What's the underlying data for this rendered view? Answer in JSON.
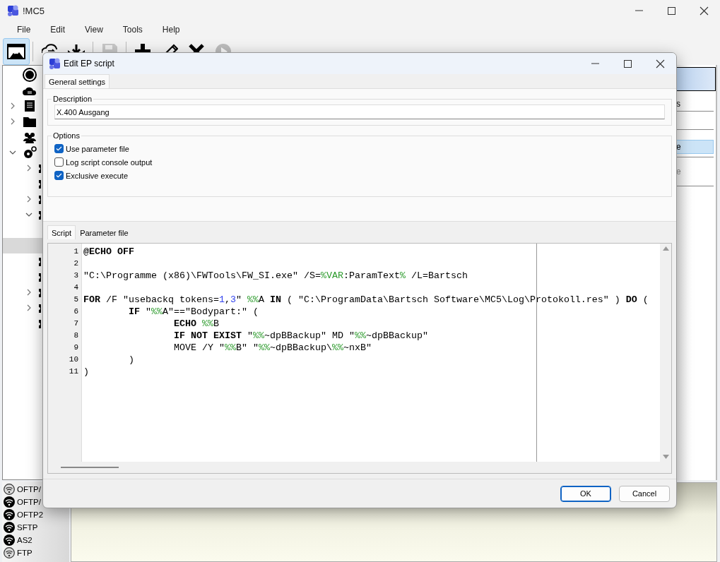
{
  "window": {
    "title": "!MC5"
  },
  "menu": [
    "File",
    "Edit",
    "View",
    "Tools",
    "Help"
  ],
  "toolbar": [
    {
      "kind": "button",
      "pressed": true,
      "disabled": false
    },
    {
      "kind": "separator"
    },
    {
      "kind": "button",
      "pressed": false,
      "disabled": false
    },
    {
      "kind": "button",
      "pressed": false,
      "disabled": false
    },
    {
      "kind": "separator"
    },
    {
      "kind": "button",
      "pressed": false,
      "disabled": true
    },
    {
      "kind": "separator"
    },
    {
      "kind": "button",
      "pressed": false,
      "disabled": false
    },
    {
      "kind": "button",
      "pressed": false,
      "disabled": false
    },
    {
      "kind": "button",
      "pressed": false,
      "disabled": false
    },
    {
      "kind": "button",
      "pressed": false,
      "disabled": true
    }
  ],
  "tree": [
    {
      "selected": false
    },
    {
      "selected": false
    },
    {
      "selected": false,
      "expanded": false
    },
    {
      "selected": false,
      "expanded": false
    },
    {
      "selected": false
    },
    {
      "selected": false,
      "expanded": true,
      "children": [
        {
          "selected": false,
          "expanded": false
        },
        {
          "selected": false
        },
        {
          "selected": false,
          "expanded": false
        },
        {
          "selected": false,
          "expanded": true,
          "children": [
            {
              "selected": false
            },
            {
              "selected": true
            }
          ]
        },
        {
          "selected": false
        },
        {
          "selected": false
        },
        {
          "selected": false,
          "expanded": false
        },
        {
          "selected": false,
          "expanded": false
        },
        {
          "selected": false
        }
      ]
    }
  ],
  "protocols": [
    {
      "label": "OFTP/",
      "active": false
    },
    {
      "label": "OFTP/",
      "active": true
    },
    {
      "label": "OFTP2",
      "active": true
    },
    {
      "label": "SFTP",
      "active": true
    },
    {
      "label": "AS2",
      "active": true
    },
    {
      "label": "FTP",
      "active": false
    }
  ],
  "right_panel": {
    "items": [
      {
        "label": "s",
        "selected": false,
        "disabled": false
      },
      {
        "label": "e",
        "selected": true,
        "disabled": false
      },
      {
        "label": "e",
        "selected": false,
        "disabled": true
      }
    ]
  },
  "dialog": {
    "title": "Edit EP script",
    "tabs": [
      {
        "label": "General settings",
        "selected": true
      }
    ],
    "description": {
      "label": "Description",
      "value": "X.400 Ausgang"
    },
    "options": {
      "label": "Options",
      "items": [
        {
          "label": "Use parameter file",
          "checked": true
        },
        {
          "label": "Log script console output",
          "checked": false
        },
        {
          "label": "Exclusive execute",
          "checked": true
        }
      ]
    },
    "editor_tabs": [
      {
        "label": "Script",
        "selected": true
      },
      {
        "label": "Parameter file",
        "selected": false
      }
    ],
    "script": [
      {
        "number": "1",
        "tokens": [
          {
            "kind": "keyword",
            "text": "@ECHO OFF"
          }
        ]
      },
      {
        "number": "2"
      },
      {
        "number": "3",
        "tokens": [
          {
            "kind": "plain",
            "text": "\"C:\\Programme (x86)\\FWTools\\FW_SI.exe\" /S="
          },
          {
            "kind": "variable",
            "text": "%VAR"
          },
          {
            "kind": "plain",
            "text": ":ParamText"
          },
          {
            "kind": "variable",
            "text": "%"
          },
          {
            "kind": "plain",
            "text": " /L=Bartsch"
          }
        ]
      },
      {
        "number": "4"
      },
      {
        "number": "5",
        "tokens": [
          {
            "kind": "keyword",
            "text": "FOR"
          },
          {
            "kind": "plain",
            "text": " /F \"usebackq tokens="
          },
          {
            "kind": "number",
            "text": "1"
          },
          {
            "kind": "plain",
            "text": ","
          },
          {
            "kind": "number",
            "text": "3"
          },
          {
            "kind": "plain",
            "text": "\" "
          },
          {
            "kind": "variable",
            "text": "%%"
          },
          {
            "kind": "plain",
            "text": "A "
          },
          {
            "kind": "keyword",
            "text": "IN"
          },
          {
            "kind": "plain",
            "text": " ( \"C:\\ProgramData\\Bartsch Software\\MC5\\Log\\Protokoll.res\" ) "
          },
          {
            "kind": "keyword",
            "text": "DO"
          },
          {
            "kind": "plain",
            "text": " ("
          }
        ]
      },
      {
        "number": "6",
        "tokens": [
          {
            "kind": "keyword",
            "text": "        IF"
          },
          {
            "kind": "plain",
            "text": " \""
          },
          {
            "kind": "variable",
            "text": "%%"
          },
          {
            "kind": "plain",
            "text": "A\"==\"Bodypart:\" ("
          }
        ]
      },
      {
        "number": "7",
        "tokens": [
          {
            "kind": "keyword",
            "text": "                ECHO"
          },
          {
            "kind": "variable",
            "text": " %%"
          },
          {
            "kind": "plain",
            "text": "B"
          }
        ]
      },
      {
        "number": "8",
        "tokens": [
          {
            "kind": "keyword",
            "text": "                IF NOT EXIST"
          },
          {
            "kind": "plain",
            "text": " \""
          },
          {
            "kind": "variable",
            "text": "%%"
          },
          {
            "kind": "plain",
            "text": "~dpBBackup\" MD \""
          },
          {
            "kind": "variable",
            "text": "%%"
          },
          {
            "kind": "plain",
            "text": "~dpBBackup\""
          }
        ]
      },
      {
        "number": "9",
        "tokens": [
          {
            "kind": "plain",
            "text": "                MOVE /Y \""
          },
          {
            "kind": "variable",
            "text": "%%"
          },
          {
            "kind": "plain",
            "text": "B\" \""
          },
          {
            "kind": "variable",
            "text": "%%"
          },
          {
            "kind": "plain",
            "text": "~dpBBackup\\"
          },
          {
            "kind": "variable",
            "text": "%%"
          },
          {
            "kind": "plain",
            "text": "~nxB\""
          }
        ]
      },
      {
        "number": "10",
        "tokens": [
          {
            "kind": "plain",
            "text": "        )"
          }
        ]
      },
      {
        "number": "11",
        "tokens": [
          {
            "kind": "plain",
            "text": ")"
          }
        ]
      }
    ],
    "buttons": [
      {
        "label": "OK",
        "default": true
      },
      {
        "label": "Cancel",
        "default": false
      }
    ]
  }
}
